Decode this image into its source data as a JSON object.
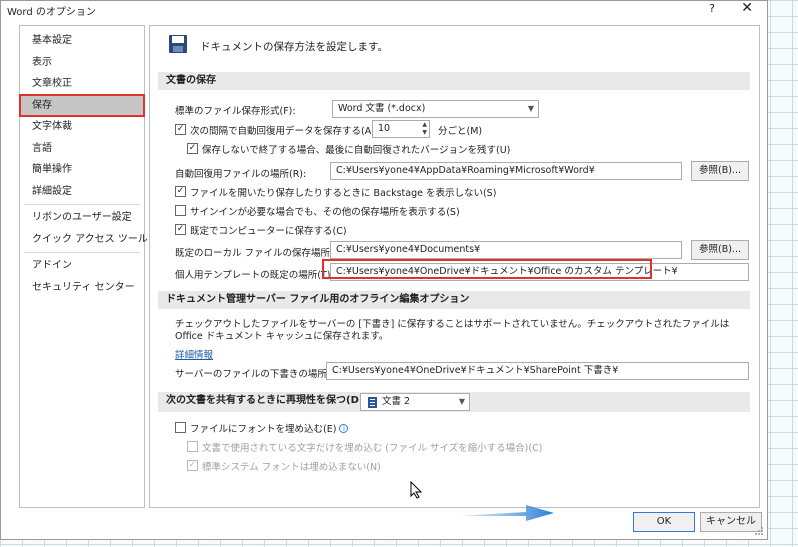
{
  "window": {
    "title": "Word のオプション",
    "help": "?",
    "close": "✕"
  },
  "sidebar": {
    "items": [
      {
        "label": "基本設定"
      },
      {
        "label": "表示"
      },
      {
        "label": "文章校正"
      },
      {
        "label": "保存",
        "selected": true
      },
      {
        "label": "文字体裁"
      },
      {
        "label": "言語"
      },
      {
        "label": "簡単操作"
      },
      {
        "label": "詳細設定"
      },
      {
        "label": "リボンのユーザー設定"
      },
      {
        "label": "クイック アクセス ツール バー"
      },
      {
        "label": "アドイン"
      },
      {
        "label": "セキュリティ センター"
      }
    ]
  },
  "main": {
    "header": "ドキュメントの保存方法を設定します。",
    "save_section": {
      "title": "文書の保存",
      "format_label": "標準のファイル保存形式(F):",
      "format_value": "Word 文書 (*.docx)",
      "autosave_label": "次の間隔で自動回復用データを保存する(A):",
      "autosave_minutes": "10",
      "autosave_unit": "分ごと(M)",
      "keep_last_label": "保存しないで終了する場合、最後に自動回復されたバージョンを残す(U)",
      "autorecover_path_label": "自動回復用ファイルの場所(R):",
      "autorecover_path_value": "C:¥Users¥yone4¥AppData¥Roaming¥Microsoft¥Word¥",
      "browse_label": "参照(B)...",
      "backstage_label": "ファイルを開いたり保存したりするときに Backstage を表示しない(S)",
      "signin_label": "サインインが必要な場合でも、その他の保存場所を表示する(S)",
      "computer_default_label": "既定でコンピューターに保存する(C)",
      "local_path_label": "既定のローカル ファイルの保存場所(I):",
      "local_path_value": "C:¥Users¥yone4¥Documents¥",
      "browse2_label": "参照(B)...",
      "template_path_label": "個人用テンプレートの既定の場所(T):",
      "template_path_value": "C:¥Users¥yone4¥OneDrive¥ドキュメント¥Office のカスタム テンプレート¥"
    },
    "offline_section": {
      "title": "ドキュメント管理サーバー ファイル用のオフライン編集オプション",
      "notice": "チェックアウトしたファイルをサーバーの [下書き] に保存することはサポートされていません。チェックアウトされたファイルは Office ドキュメント キャッシュに保存されます。",
      "details_link": "詳細情報",
      "drafts_label": "サーバーのファイルの下書きの場所(V):",
      "drafts_value": "C:¥Users¥yone4¥OneDrive¥ドキュメント¥SharePoint 下書き¥"
    },
    "fidelity_section": {
      "title": "次の文書を共有するときに再現性を保つ(D):",
      "doc_value": "文書 2",
      "embed_fonts_label": "ファイルにフォントを埋め込む(E)",
      "embed_used_label": "文書で使用されている文字だけを埋め込む (ファイル サイズを縮小する場合)(C)",
      "no_common_label": "標準システム フォントは埋め込まない(N)"
    }
  },
  "footer": {
    "ok": "OK",
    "cancel": "キャンセル"
  }
}
